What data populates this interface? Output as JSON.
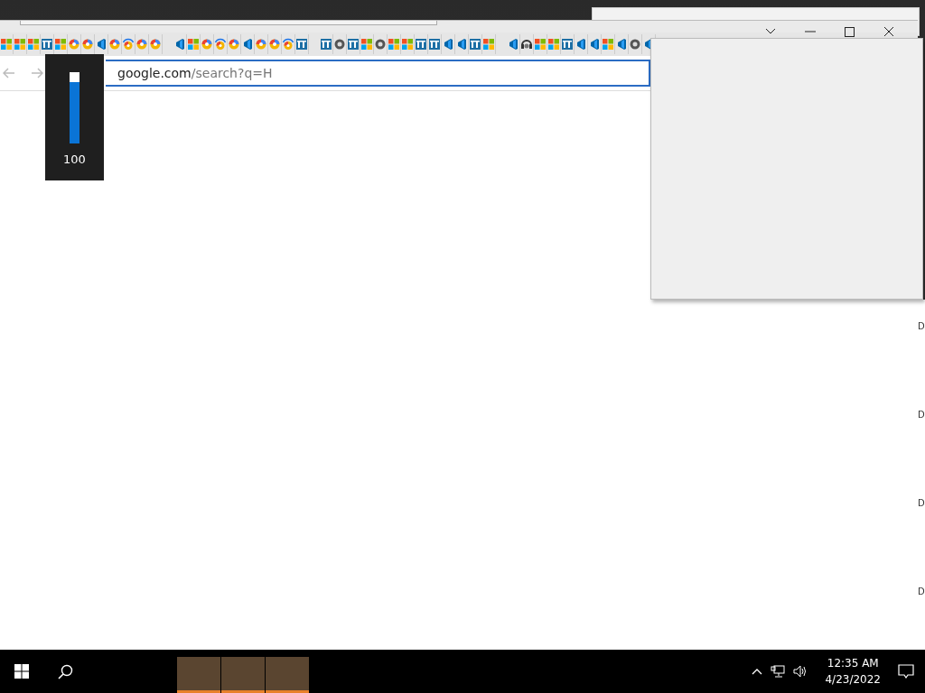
{
  "browser": {
    "tab_groups": [
      [
        {
          "kind": "windows"
        },
        {
          "kind": "windows"
        },
        {
          "kind": "windows"
        },
        {
          "kind": "library"
        },
        {
          "kind": "windows"
        },
        {
          "kind": "edge"
        },
        {
          "kind": "edge"
        },
        {
          "kind": "code"
        },
        {
          "kind": "edge"
        },
        {
          "kind": "edge-arc"
        },
        {
          "kind": "edge"
        },
        {
          "kind": "edge"
        }
      ],
      [
        {
          "kind": "code"
        },
        {
          "kind": "windows"
        },
        {
          "kind": "edge"
        },
        {
          "kind": "edge-arc"
        },
        {
          "kind": "edge"
        },
        {
          "kind": "code"
        },
        {
          "kind": "edge"
        },
        {
          "kind": "edge"
        },
        {
          "kind": "edge-arc"
        },
        {
          "kind": "library"
        }
      ],
      [
        {
          "kind": "library"
        },
        {
          "kind": "chrome"
        },
        {
          "kind": "library"
        },
        {
          "kind": "windows"
        },
        {
          "kind": "chrome"
        },
        {
          "kind": "windows"
        },
        {
          "kind": "windows"
        },
        {
          "kind": "library"
        },
        {
          "kind": "library"
        },
        {
          "kind": "code"
        },
        {
          "kind": "code"
        },
        {
          "kind": "library"
        },
        {
          "kind": "windows"
        }
      ],
      [
        {
          "kind": "code"
        },
        {
          "kind": "person"
        },
        {
          "kind": "windows"
        },
        {
          "kind": "windows"
        },
        {
          "kind": "library"
        },
        {
          "kind": "code"
        },
        {
          "kind": "code"
        },
        {
          "kind": "windows"
        },
        {
          "kind": "code"
        },
        {
          "kind": "chrome"
        },
        {
          "kind": "code"
        }
      ]
    ],
    "back_disabled": true,
    "forward_disabled": true,
    "url_host": "google.com",
    "url_path": "/search?q=H"
  },
  "volume_flyout": {
    "level": 0.86,
    "reading": "100"
  },
  "background_window": {
    "edge_letters": [
      "D",
      "D",
      "D",
      "D"
    ]
  },
  "taskbar": {
    "apps": [
      {
        "running": true
      },
      {
        "running": true
      },
      {
        "running": true
      }
    ],
    "time": "12:35 AM",
    "date": "4/23/2022"
  }
}
